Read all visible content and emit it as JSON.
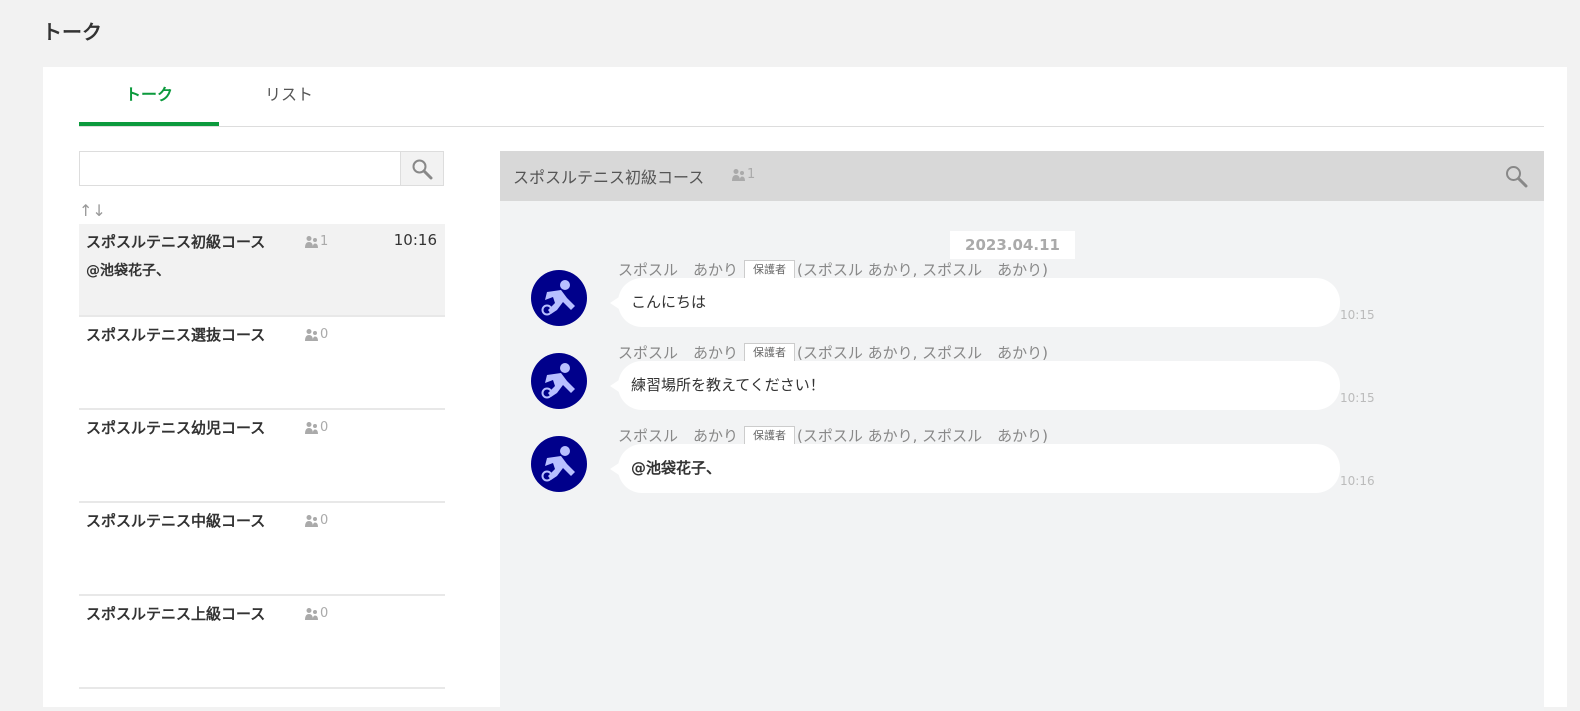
{
  "page": {
    "title": "トーク"
  },
  "tabs": [
    {
      "label": "トーク",
      "active": true
    },
    {
      "label": "リスト",
      "active": false
    }
  ],
  "search": {
    "placeholder": "",
    "value": ""
  },
  "sort_icon": "↑↓",
  "rooms": [
    {
      "name": "スポスルテニス初級コース",
      "members": "1",
      "time": "10:16",
      "preview": "@池袋花子、",
      "selected": true
    },
    {
      "name": "スポスルテニス選抜コース",
      "members": "0",
      "time": "",
      "preview": "",
      "selected": false
    },
    {
      "name": "スポスルテニス幼児コース",
      "members": "0",
      "time": "",
      "preview": "",
      "selected": false
    },
    {
      "name": "スポスルテニス中級コース",
      "members": "0",
      "time": "",
      "preview": "",
      "selected": false
    },
    {
      "name": "スポスルテニス上級コース",
      "members": "0",
      "time": "",
      "preview": "",
      "selected": false
    }
  ],
  "chat": {
    "title": "スポスルテニス初級コース",
    "members": "1",
    "date": "2023.04.11",
    "messages": [
      {
        "sender_name": "スポスル　あかり",
        "badge": "保護者",
        "sender_detail": "(スポスル あかり, スポスル　あかり)",
        "text": "こんにちは",
        "time": "10:15",
        "bold": false
      },
      {
        "sender_name": "スポスル　あかり",
        "badge": "保護者",
        "sender_detail": "(スポスル あかり, スポスル　あかり)",
        "text": "練習場所を教えてください！",
        "time": "10:15",
        "bold": false
      },
      {
        "sender_name": "スポスル　あかり",
        "badge": "保護者",
        "sender_detail": "(スポスル あかり, スポスル　あかり)",
        "text": "@池袋花子、",
        "time": "10:16",
        "bold": true
      }
    ]
  },
  "colors": {
    "accent": "#0c9a3d",
    "avatar_bg": "#00008b",
    "header_bg": "#d8d8d8"
  },
  "icons": {
    "search": "search-icon",
    "members": "members-icon",
    "avatar": "soccer-player-icon"
  }
}
